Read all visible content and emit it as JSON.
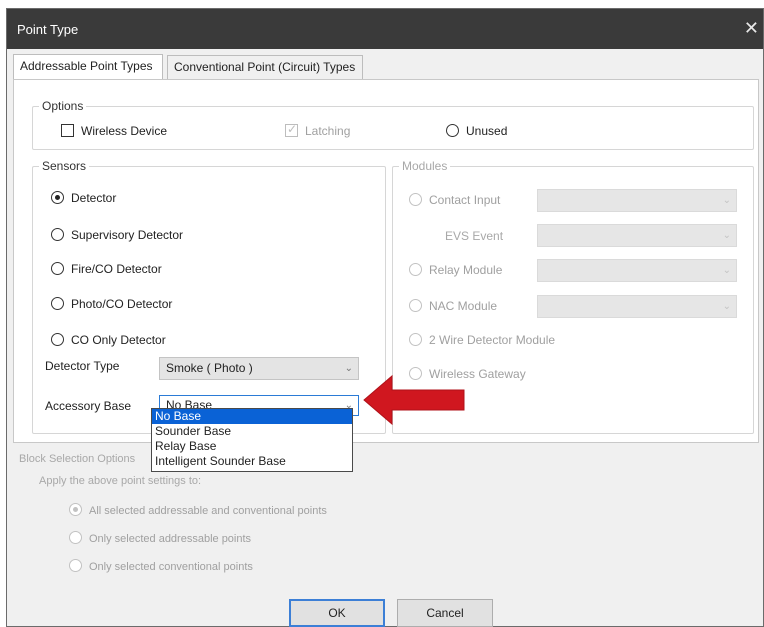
{
  "window": {
    "title": "Point Type",
    "close_glyph": "✕"
  },
  "tabs": [
    {
      "label": "Addressable Point Types",
      "active": true
    },
    {
      "label": "Conventional Point (Circuit) Types",
      "active": false
    }
  ],
  "options": {
    "legend": "Options",
    "wireless_device": "Wireless Device",
    "latching": "Latching",
    "unused": "Unused"
  },
  "sensors": {
    "legend": "Sensors",
    "items": [
      {
        "label": "Detector",
        "selected": true
      },
      {
        "label": "Supervisory Detector",
        "selected": false
      },
      {
        "label": "Fire/CO Detector",
        "selected": false
      },
      {
        "label": "Photo/CO Detector",
        "selected": false
      },
      {
        "label": "CO Only Detector",
        "selected": false
      }
    ],
    "detector_type_label": "Detector Type",
    "detector_type_value": "Smoke ( Photo )",
    "accessory_base_label": "Accessory Base",
    "accessory_base_value": "No Base",
    "accessory_base_options": [
      "No Base",
      "Sounder Base",
      "Relay Base",
      "Intelligent Sounder Base"
    ],
    "accessory_base_highlighted": "No Base"
  },
  "modules": {
    "legend": "Modules",
    "contact_input": "Contact Input",
    "evs_event": "EVS Event",
    "relay_module": "Relay Module",
    "nac_module": "NAC Module",
    "two_wire": "2 Wire Detector Module",
    "wireless_gateway": "Wireless Gateway"
  },
  "block_selection": {
    "legend": "Block Selection Options",
    "apply_text": "Apply the above point settings to:",
    "items": [
      {
        "label": "All selected addressable and conventional points",
        "selected": true
      },
      {
        "label": "Only selected addressable points",
        "selected": false
      },
      {
        "label": "Only selected conventional points",
        "selected": false
      }
    ]
  },
  "buttons": {
    "ok": "OK",
    "cancel": "Cancel"
  },
  "colors": {
    "titlebar": "#3a3a3a",
    "selection": "#0a62d6",
    "arrow": "#d0171f"
  },
  "icons": {
    "close": "close-icon",
    "chevron": "chevron-down-icon",
    "annotation": "red-arrow-icon"
  }
}
